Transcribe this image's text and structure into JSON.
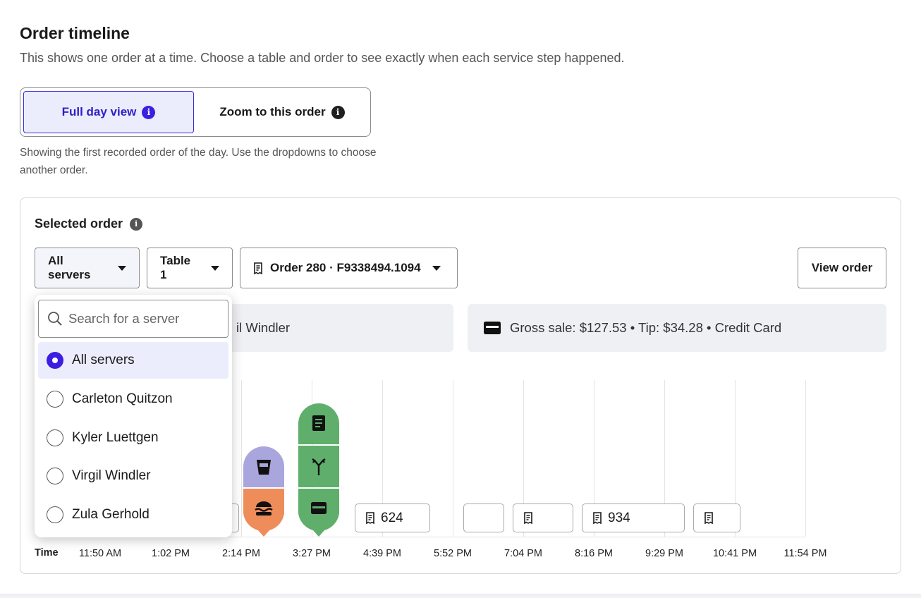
{
  "header": {
    "title": "Order timeline",
    "subtitle": "This shows one order at a time. Choose a table and order to see exactly when each service step happened."
  },
  "view_toggle": {
    "options": [
      "Full day view",
      "Zoom to this order"
    ],
    "selected": "Full day view",
    "helper": "Showing the first recorded order of the day. Use the dropdowns to choose another order."
  },
  "selected_order": {
    "title": "Selected order",
    "server_dropdown": "All servers",
    "table_dropdown": "Table 1",
    "order_dropdown": "Order 280 · F9338494.1094",
    "view_button": "View order",
    "server_panel_text": "il Windler",
    "payment_panel_text": "Gross sale: $127.53 • Tip: $34.28 • Credit Card"
  },
  "server_menu": {
    "search_placeholder": "Search for a server",
    "options": [
      "All servers",
      "Carleton Quitzon",
      "Kyler Luettgen",
      "Virgil Windler",
      "Zula Gerhold"
    ],
    "selected": "All servers"
  },
  "timeline": {
    "axis_title": "Time",
    "ticks": [
      "11:50 AM",
      "1:02 PM",
      "2:14 PM",
      "3:27 PM",
      "4:39 PM",
      "5:52 PM",
      "7:04 PM",
      "8:16 PM",
      "9:29 PM",
      "10:41 PM",
      "11:54 PM"
    ],
    "order_boxes": [
      {
        "label": "624",
        "icon": "receipt-icon"
      },
      {
        "label": "",
        "icon": ""
      },
      {
        "label": "",
        "icon": "receipt-icon"
      },
      {
        "label": "934",
        "icon": "receipt-icon"
      },
      {
        "label": "",
        "icon": "receipt-icon"
      }
    ],
    "steps": [
      {
        "time": "2:14 PM",
        "icons": [
          "drink-icon",
          "burger-icon"
        ],
        "colors": [
          "#a9a5dd",
          "#ee8c5a"
        ]
      },
      {
        "time": "3:27 PM",
        "icons": [
          "receipt-icon",
          "split-icon",
          "card-icon"
        ],
        "colors": [
          "#5fae6c",
          "#5fae6c",
          "#5fae6c"
        ]
      }
    ],
    "colors": {
      "drink": "#a9a5dd",
      "food": "#ee8c5a",
      "payment": "#5fae6c",
      "accent": "#3b1fe0"
    }
  }
}
